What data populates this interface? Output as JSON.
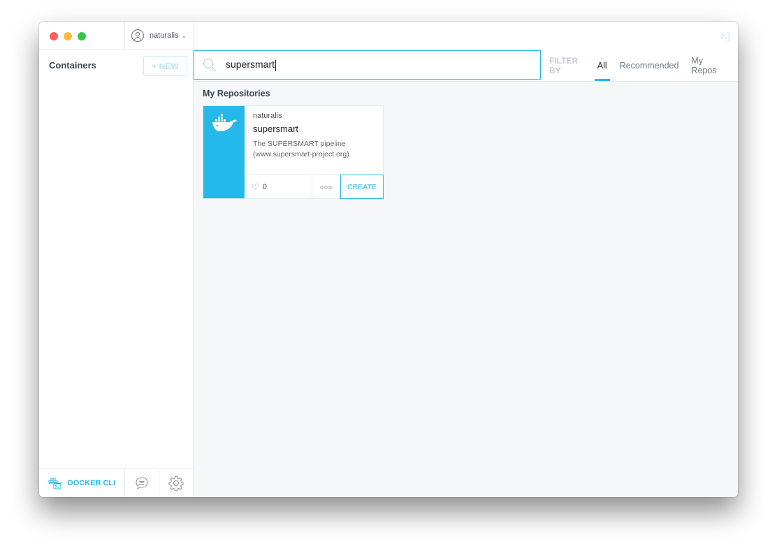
{
  "window": {
    "user": {
      "name": "naturalis",
      "menu_icon": "chevron-down-icon"
    },
    "logo": "K]"
  },
  "sidebar": {
    "title": "Containers",
    "new_button": "+ NEW",
    "footer": {
      "docker_cli": "DOCKER CLI",
      "chat_icon": "chat-bubble-icon",
      "settings_icon": "gear-icon"
    }
  },
  "search": {
    "value": "supersmart",
    "icon": "search-icon"
  },
  "filter": {
    "label": "FILTER BY",
    "tabs": [
      {
        "label": "All",
        "active": true
      },
      {
        "label": "Recommended",
        "active": false
      },
      {
        "label": "My Repos",
        "active": false
      }
    ]
  },
  "results": {
    "section_title": "My Repositories",
    "cards": [
      {
        "owner": "naturalis",
        "name": "supersmart",
        "description_line1": "The SUPERSMART pipeline",
        "description_line2": "(www.supersmart-project.org)",
        "likes": "0",
        "more": "ooo",
        "create_label": "CREATE",
        "accent_color": "#24b8eb"
      }
    ]
  },
  "colors": {
    "accent": "#24b8eb",
    "traffic_red": "#fc605c",
    "traffic_yellow": "#fdbc40",
    "traffic_green": "#34c84a"
  }
}
